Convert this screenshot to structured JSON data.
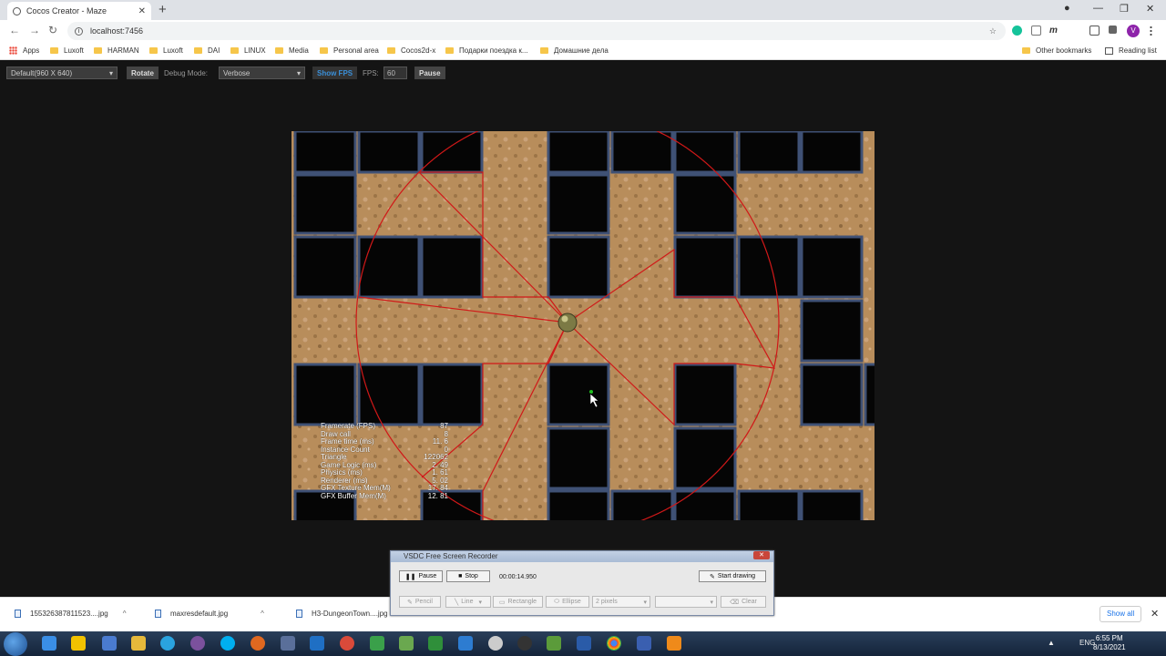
{
  "browser": {
    "tab_title": "Cocos Creator - Maze",
    "url": "localhost:7456",
    "profile_initial": "V",
    "bookmarks": [
      "Apps",
      "Luxoft",
      "HARMAN",
      "Luxoft",
      "DAI",
      "LINUX",
      "Media",
      "Personal area",
      "Cocos2d-x",
      "Подарки поездка к...",
      "Домашние дела"
    ],
    "other_bookmarks": "Other bookmarks",
    "reading_list": "Reading list"
  },
  "game_toolbar": {
    "resolution": "Default(960 X 640)",
    "rotate": "Rotate",
    "debug_mode_label": "Debug Mode:",
    "debug_mode": "Verbose",
    "show_fps": "Show FPS",
    "fps_label": "FPS:",
    "fps_value": "60",
    "pause": "Pause"
  },
  "stats": [
    {
      "label": "Framerate (FPS)",
      "value": "87"
    },
    {
      "label": "Draw call",
      "value": "8"
    },
    {
      "label": "Frame time (ms)",
      "value": "11. 6"
    },
    {
      "label": "Instance Count",
      "value": "0"
    },
    {
      "label": "Triangle",
      "value": "122062"
    },
    {
      "label": "Game Logic (ms)",
      "value": "2. 49"
    },
    {
      "label": "Physics (ms)",
      "value": "1. 61"
    },
    {
      "label": "Renderer (ms)",
      "value": "5. 02"
    },
    {
      "label": "GFX Texture Mem(M)",
      "value": "17. 84"
    },
    {
      "label": "GFX Buffer Mem(M)",
      "value": "12. 81"
    }
  ],
  "recorder": {
    "title": "VSDC Free Screen Recorder",
    "pause": "Pause",
    "stop": "Stop",
    "timer": "00:00:14.950",
    "start_drawing": "Start drawing",
    "pencil": "Pencil",
    "line": "Line",
    "rectangle": "Rectangle",
    "ellipse": "Ellipse",
    "pixels": "2 pixels",
    "clear": "Clear"
  },
  "downloads": {
    "items": [
      "155326387811523....jpg",
      "maxresdefault.jpg",
      "H3-DungeonTown....jpg"
    ],
    "show_all": "Show all"
  },
  "taskbar": {
    "lang": "ENG",
    "time": "6:55 PM",
    "date": "8/13/2021"
  },
  "colors": {
    "accent": "#1a73e8",
    "show_fps": "#3a8fd8",
    "ray": "#d01818",
    "sand": "#b88d5b",
    "hole": "#050505"
  }
}
